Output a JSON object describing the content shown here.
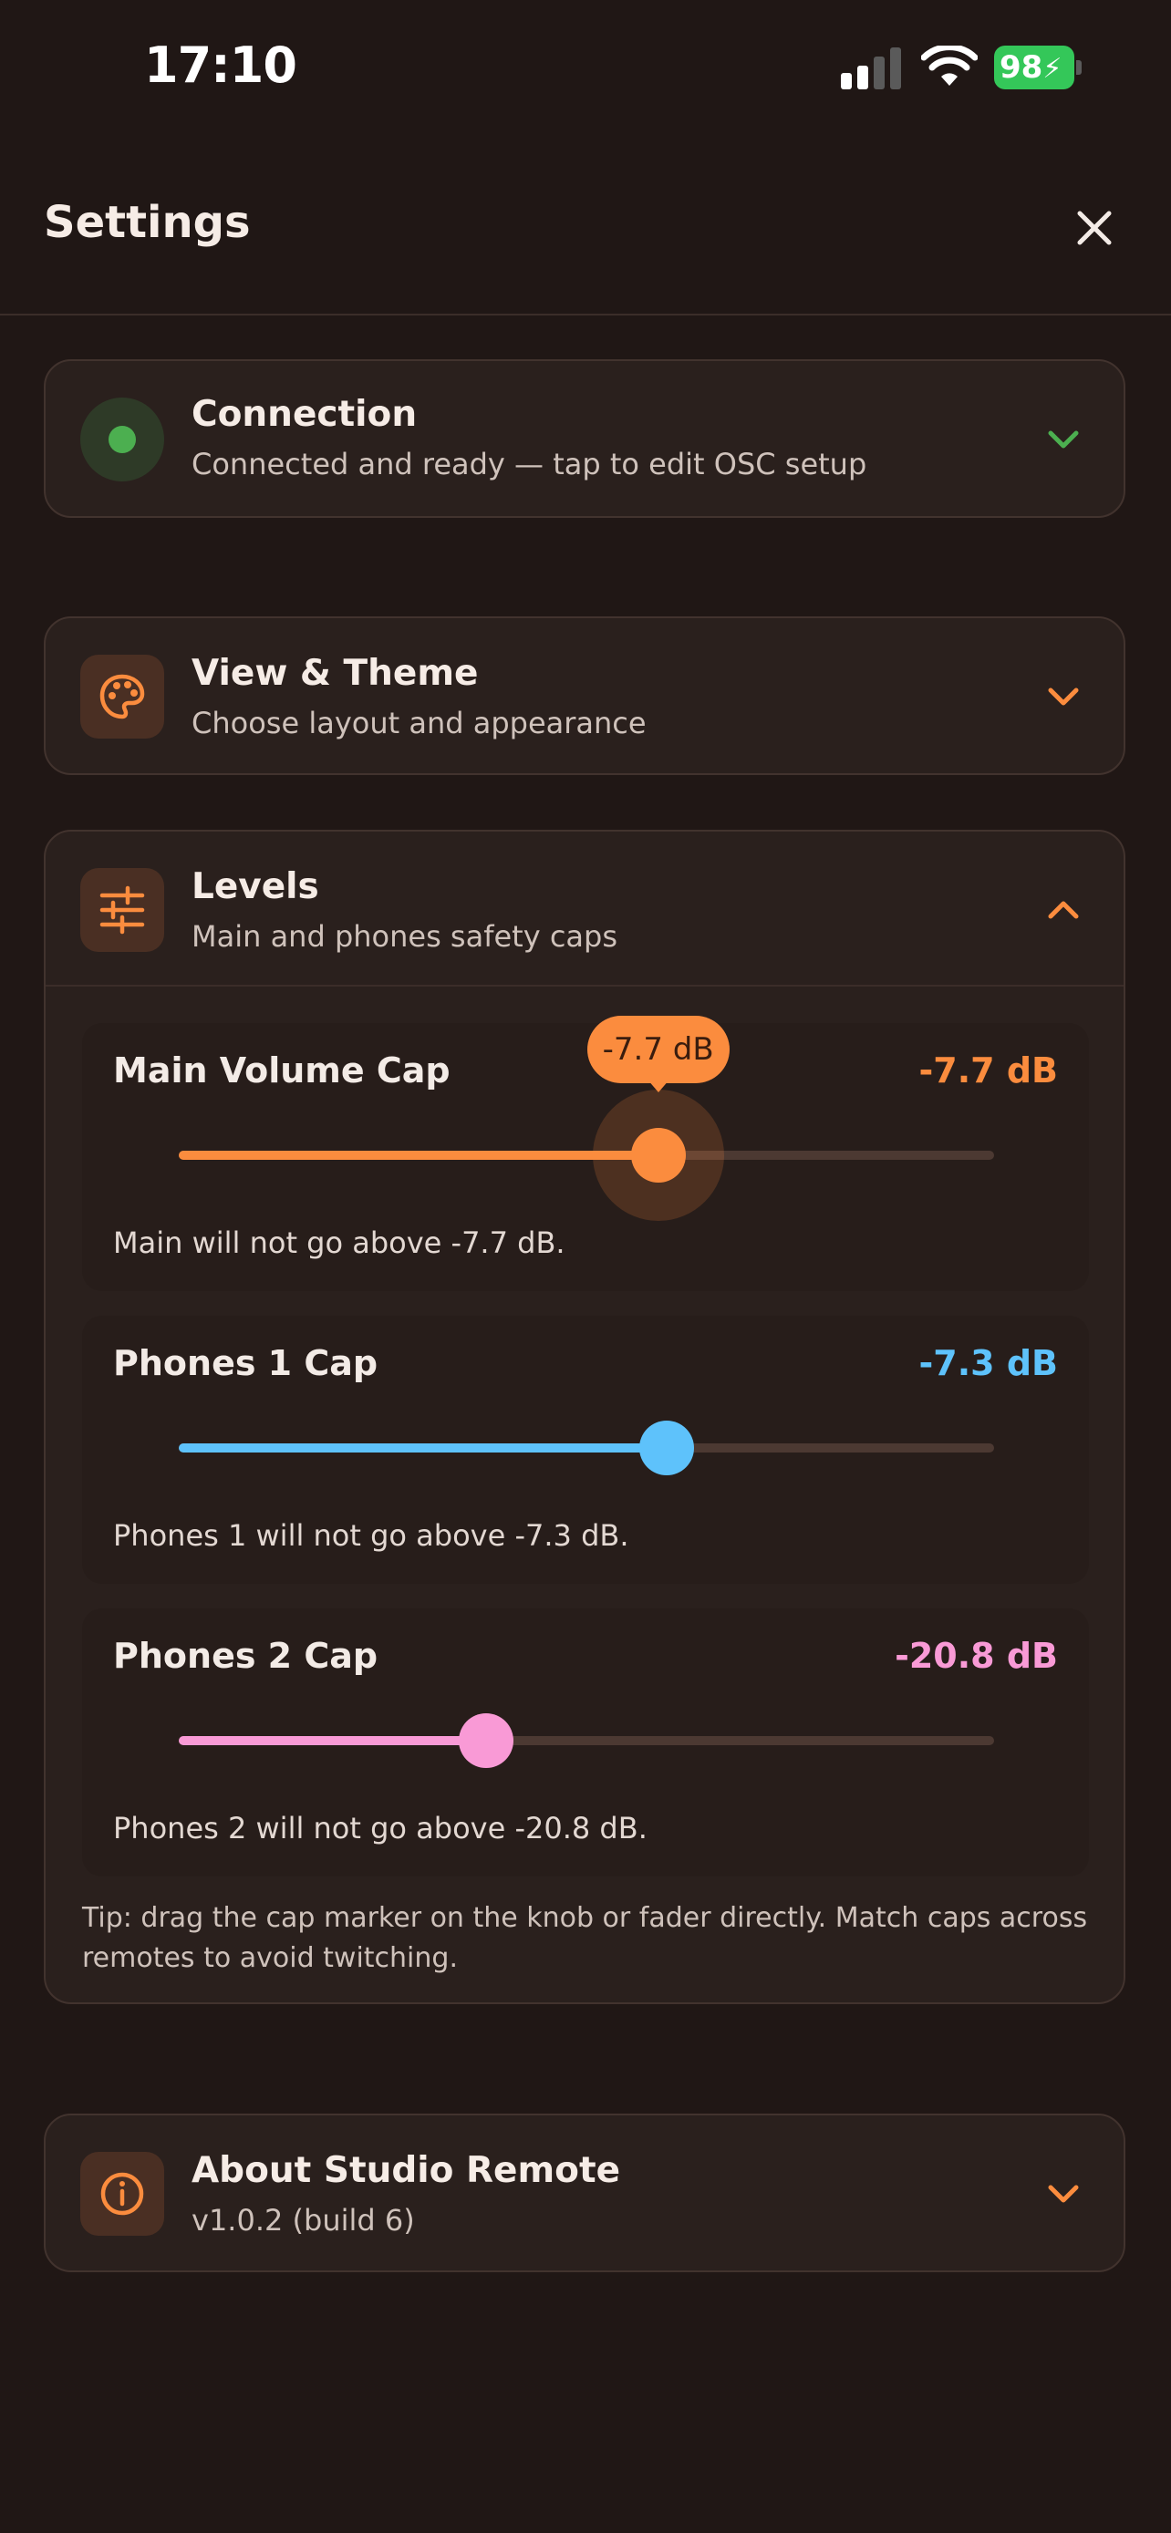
{
  "status_bar": {
    "time": "17:10",
    "battery": "98",
    "icons": [
      "cellular-signal-icon",
      "wifi-icon",
      "battery-charging-icon"
    ]
  },
  "header": {
    "title": "Settings",
    "close_icon": "close-icon"
  },
  "sections": {
    "connection": {
      "title": "Connection",
      "subtitle": "Connected and ready — tap to edit OSC setup",
      "icon": "status-dot-icon",
      "status_color": "#4caf50",
      "expanded": false
    },
    "view_theme": {
      "title": "View & Theme",
      "subtitle": "Choose layout and appearance",
      "icon": "palette-icon",
      "expanded": false
    },
    "levels": {
      "title": "Levels",
      "subtitle": "Main and phones safety caps",
      "icon": "sliders-icon",
      "expanded": true,
      "sliders": [
        {
          "label": "Main Volume Cap",
          "value_text": "-7.7 dB",
          "bubble_text": "-7.7 dB",
          "note": "Main will not go above -7.7 dB.",
          "fraction": 0.588,
          "color": "#fb8c3e",
          "active": true
        },
        {
          "label": "Phones 1 Cap",
          "value_text": "-7.3 dB",
          "note": "Phones 1 will not go above -7.3 dB.",
          "fraction": 0.598,
          "color": "#5ec2fb",
          "active": false
        },
        {
          "label": "Phones 2 Cap",
          "value_text": "-20.8 dB",
          "note": "Phones 2 will not go above -20.8 dB.",
          "fraction": 0.377,
          "color": "#f99ad6",
          "active": false
        }
      ],
      "tip": "Tip: drag the cap marker on the knob or fader directly. Match caps across remotes to avoid twitching."
    },
    "about": {
      "title": "About Studio Remote",
      "subtitle": "v1.0.2 (build 6)",
      "icon": "info-icon",
      "expanded": false
    }
  },
  "colors": {
    "accent": "#fb8c3e",
    "background": "#201715",
    "card": "#2a201d",
    "connected_green": "#4caf50"
  }
}
